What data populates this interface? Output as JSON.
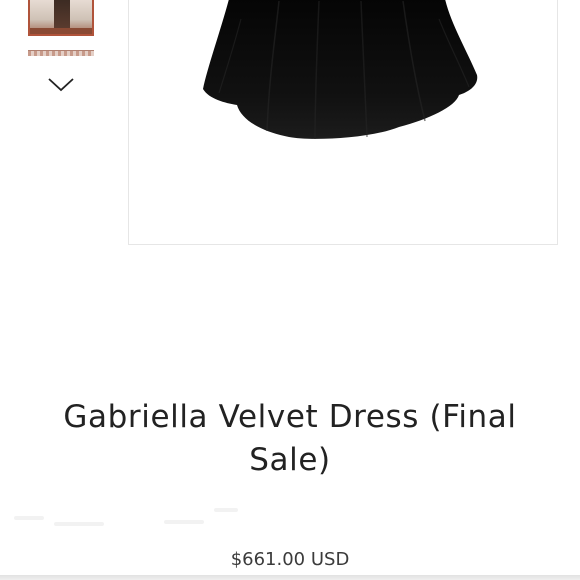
{
  "gallery": {
    "thumbnails": [
      {
        "name": "dress-front-model-photo"
      },
      {
        "name": "dress-detail-photo"
      }
    ],
    "next_icon": "chevron-down-icon",
    "main_image": {
      "name": "black-velvet-dress-skirt-photo"
    }
  },
  "product": {
    "title": "Gabriella Velvet Dress (Final Sale)",
    "price": "$661.00 USD"
  },
  "colors": {
    "text": "#222222",
    "price_text": "#3b3b3b",
    "image_border": "#e6e6e6",
    "dress": "#0a0a0a",
    "thumb_border": "#b0533a"
  }
}
